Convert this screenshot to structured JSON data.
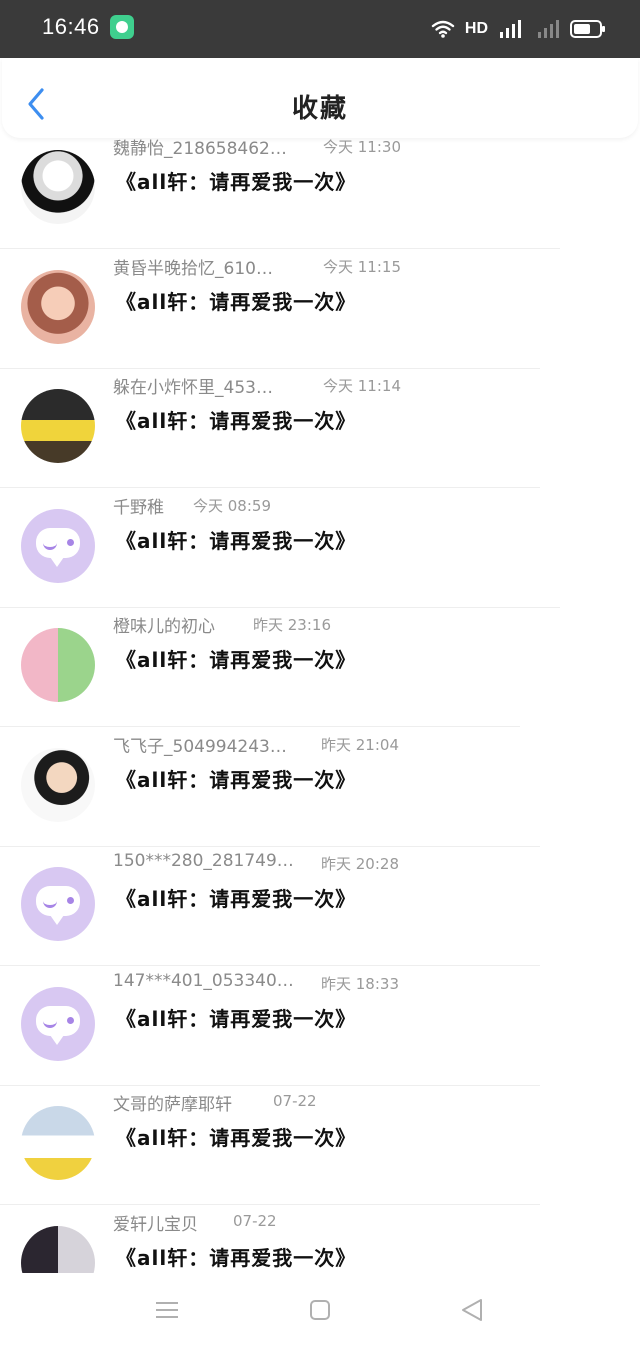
{
  "status_bar": {
    "time": "16:46",
    "network": "HD",
    "signal": "4G"
  },
  "header": {
    "title": "收藏",
    "back_icon": "chevron-left-icon"
  },
  "items": [
    {
      "name": "魏静怡_218658462…",
      "time": "今天 11:30",
      "message": "《all轩：请再爱我一次》",
      "avatar": "photo"
    },
    {
      "name": "黄昏半晚拾忆_610…",
      "time": "今天 11:15",
      "message": "《all轩：请再爱我一次》",
      "avatar": "photo"
    },
    {
      "name": "躲在小炸怀里_453…",
      "time": "今天 11:14",
      "message": "《all轩：请再爱我一次》",
      "avatar": "photo"
    },
    {
      "name": "千野稚",
      "time": "今天 08:59",
      "message": "《all轩：请再爱我一次》",
      "avatar": "default"
    },
    {
      "name": "橙味儿的初心",
      "time": "昨天 23:16",
      "message": "《all轩：请再爱我一次》",
      "avatar": "photo"
    },
    {
      "name": "飞飞子_504994243…",
      "time": "昨天 21:04",
      "message": "《all轩：请再爱我一次》",
      "avatar": "photo"
    },
    {
      "name": "150***280_281749…",
      "time": "昨天 20:28",
      "message": "《all轩：请再爱我一次》",
      "avatar": "default"
    },
    {
      "name": "147***401_053340…",
      "time": "昨天 18:33",
      "message": "《all轩：请再爱我一次》",
      "avatar": "default"
    },
    {
      "name": "文哥的萨摩耶轩",
      "time": "07-22",
      "message": "《all轩：请再爱我一次》",
      "avatar": "photo"
    },
    {
      "name": "爱轩儿宝贝",
      "time": "07-22",
      "message": "《all轩：请再爱我一次》",
      "avatar": "photo"
    }
  ],
  "colors": {
    "accent": "#3d8ef0",
    "default_avatar": "#d8c8f2",
    "status_bar": "#3a3a3a"
  },
  "bottom_nav": {
    "icons": [
      "menu-icon",
      "home-icon",
      "back-triangle-icon"
    ]
  }
}
